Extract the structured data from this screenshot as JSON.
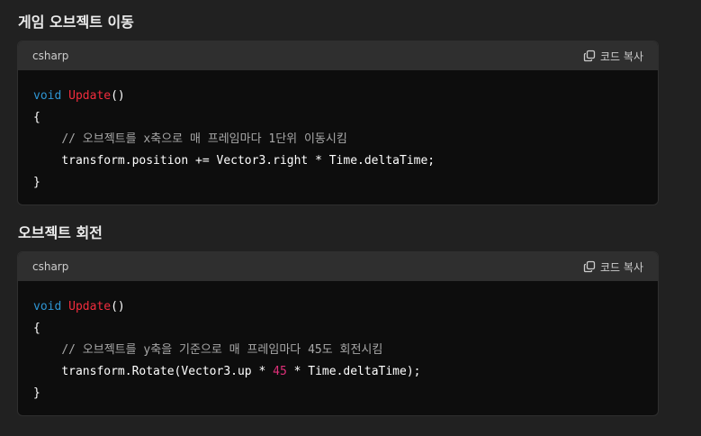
{
  "sections": [
    {
      "title": "게임 오브젝트 이동",
      "lang": "csharp",
      "copy_label": "코드 복사",
      "code": {
        "kw": "void",
        "fn": "Update",
        "parens": "()",
        "open": "{",
        "indent": "    ",
        "comment": "// 오브젝트를 x축으로 매 프레임마다 1단위 이동시킴",
        "stmt_pre": "transform.position += Vector3.right * Time.deltaTime;",
        "stmt_num": "",
        "stmt_post": "",
        "close": "}"
      }
    },
    {
      "title": "오브젝트 회전",
      "lang": "csharp",
      "copy_label": "코드 복사",
      "code": {
        "kw": "void",
        "fn": "Update",
        "parens": "()",
        "open": "{",
        "indent": "    ",
        "comment": "// 오브젝트를 y축을 기준으로 매 프레임마다 45도 회전시킴",
        "stmt_pre": "transform.Rotate(Vector3.up * ",
        "stmt_num": "45",
        "stmt_post": " * Time.deltaTime);",
        "close": "}"
      }
    }
  ],
  "colors": {
    "background": "#212121",
    "code_bg": "#0d0d0d",
    "header_bg": "#2f2f2f",
    "keyword": "#2e95d3",
    "function": "#f22c3d",
    "number": "#df3079",
    "comment": "#a8a8a8"
  },
  "icons": {
    "copy": "copy-icon"
  }
}
